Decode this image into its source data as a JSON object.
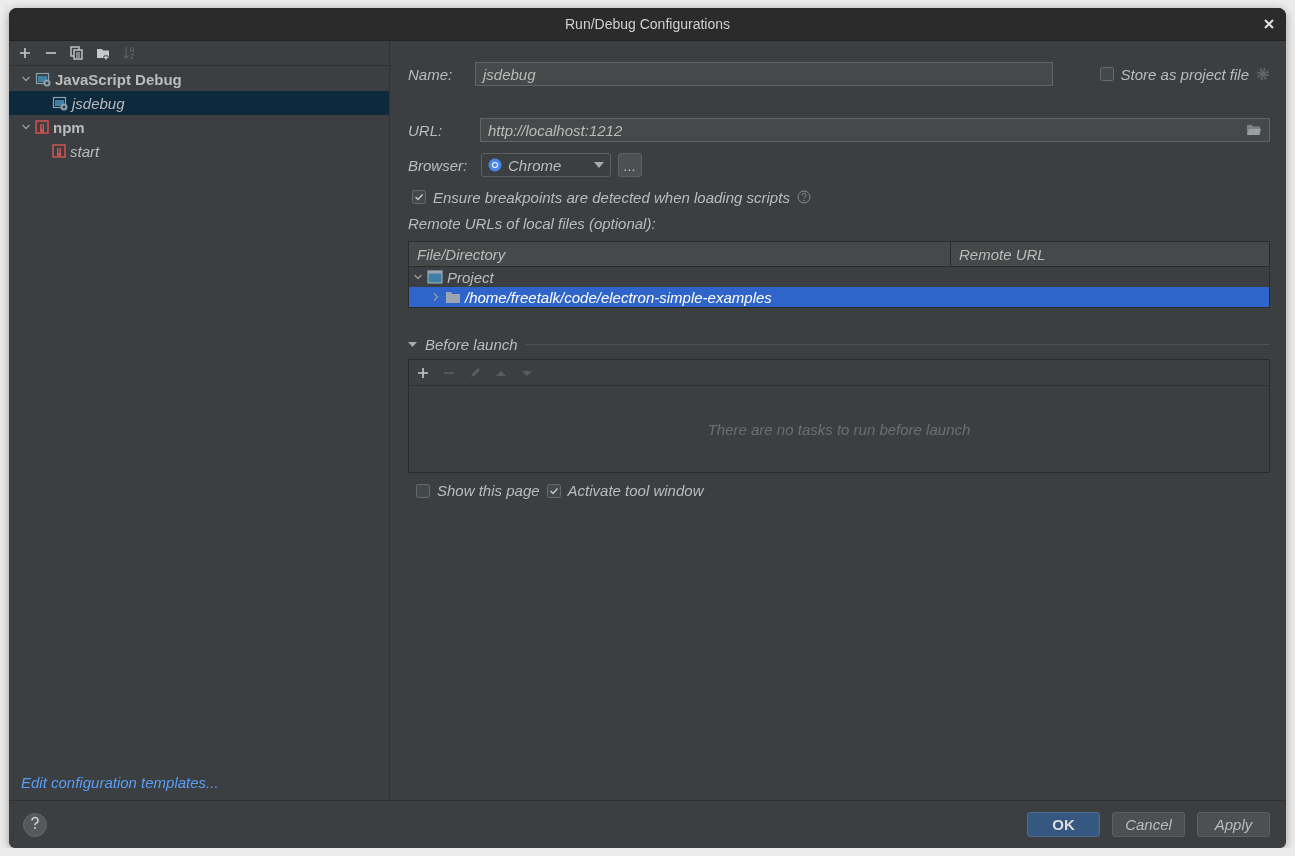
{
  "window": {
    "title": "Run/Debug Configurations"
  },
  "sidebar": {
    "toolbar": [
      {
        "kind": "add",
        "disabled": false
      },
      {
        "kind": "remove",
        "disabled": false
      },
      {
        "kind": "copy",
        "disabled": false
      },
      {
        "kind": "folder",
        "disabled": false
      },
      {
        "kind": "sort",
        "disabled": true
      }
    ],
    "tree": [
      {
        "label": "JavaScript Debug",
        "kind": "jsdebug",
        "expanded": true,
        "selected": false,
        "children": [
          {
            "label": "jsdebug",
            "kind": "jsdebug",
            "selected": true
          }
        ]
      },
      {
        "label": "npm",
        "kind": "npm",
        "expanded": true,
        "selected": false,
        "children": [
          {
            "label": "start",
            "kind": "npm",
            "selected": false
          }
        ]
      }
    ],
    "link": "Edit configuration templates..."
  },
  "form": {
    "name": {
      "label": "Name:",
      "value": "jsdebug"
    },
    "store_as_project_file": {
      "label": "Store as project file",
      "checked": false
    },
    "url": {
      "label": "URL:",
      "value": "http://localhost:1212"
    },
    "browser": {
      "label": "Browser:",
      "value": "Chrome",
      "more": "..."
    },
    "ensure_breakpoints": {
      "label": "Ensure breakpoints are detected when loading scripts",
      "checked": true
    },
    "remote_urls": {
      "label": "Remote URLs of local files (optional):",
      "columns": [
        "File/Directory",
        "Remote URL"
      ],
      "rows": [
        {
          "file": "Project",
          "kind": "module",
          "expanded": true,
          "selected": false,
          "children": [
            {
              "file": "/home/freetalk/code/electron-simple-examples",
              "kind": "folder",
              "expanded": false,
              "selected": true
            }
          ]
        }
      ]
    },
    "before_launch": {
      "title": "Before launch",
      "expanded": true,
      "toolbar": [
        {
          "kind": "add",
          "disabled": false
        },
        {
          "kind": "remove",
          "disabled": true
        },
        {
          "kind": "edit",
          "disabled": true
        },
        {
          "kind": "up",
          "disabled": true
        },
        {
          "kind": "down",
          "disabled": true
        }
      ],
      "empty_text": "There are no tasks to run before launch"
    },
    "show_this_page": {
      "label": "Show this page",
      "checked": false
    },
    "activate_tool_window": {
      "label": "Activate tool window",
      "checked": true
    }
  },
  "footer": {
    "buttons": [
      {
        "label": "OK",
        "kind": "default"
      },
      {
        "label": "Cancel",
        "kind": "normal"
      },
      {
        "label": "Apply",
        "kind": "normal"
      }
    ]
  }
}
